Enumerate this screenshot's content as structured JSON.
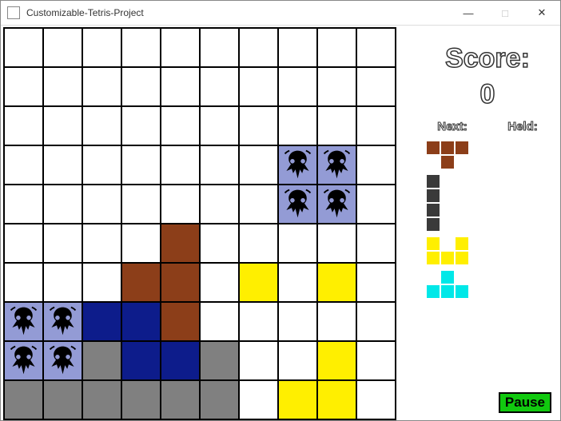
{
  "window": {
    "title": "Customizable-Tetris-Project"
  },
  "score": {
    "label": "Score:",
    "value": "0"
  },
  "labels": {
    "next": "Next:",
    "held": "Held:"
  },
  "buttons": {
    "pause": "Pause"
  },
  "colors": {
    "brown": "#8c3e19",
    "navy": "#0d1c8b",
    "yellow": "#ffef00",
    "gray": "#808080",
    "purple_skull": "#939bd5",
    "cyan": "#00e8e8",
    "dark": "#3a3a3a"
  },
  "board": {
    "cols": 10,
    "rows": 10,
    "cells": [
      [
        "",
        "",
        "",
        "",
        "",
        "",
        "",
        "",
        "",
        ""
      ],
      [
        "",
        "",
        "",
        "",
        "",
        "",
        "",
        "",
        "",
        ""
      ],
      [
        "",
        "",
        "",
        "",
        "",
        "",
        "",
        "",
        "",
        ""
      ],
      [
        "",
        "",
        "",
        "",
        "",
        "",
        "",
        "purple",
        "purple",
        ""
      ],
      [
        "",
        "",
        "",
        "",
        "",
        "",
        "",
        "purple",
        "purple",
        ""
      ],
      [
        "",
        "",
        "",
        "",
        "brown",
        "",
        "",
        "",
        "",
        ""
      ],
      [
        "",
        "",
        "",
        "brown",
        "brown",
        "",
        "yellow",
        "",
        "yellow",
        ""
      ],
      [
        "purple",
        "purple",
        "navy",
        "navy",
        "brown",
        "",
        "",
        "",
        "",
        ""
      ],
      [
        "purple",
        "purple",
        "gray",
        "navy",
        "navy",
        "gray",
        "",
        "",
        "yellow",
        ""
      ],
      [
        "gray",
        "gray",
        "gray",
        "gray",
        "gray",
        "gray",
        "",
        "yellow",
        "yellow",
        ""
      ]
    ]
  },
  "next_queue": [
    {
      "type": "T",
      "color": "brown"
    },
    {
      "type": "I",
      "color": "dark"
    },
    {
      "type": "U",
      "color": "yellow"
    },
    {
      "type": "T_up",
      "color": "cyan"
    }
  ],
  "held": null
}
